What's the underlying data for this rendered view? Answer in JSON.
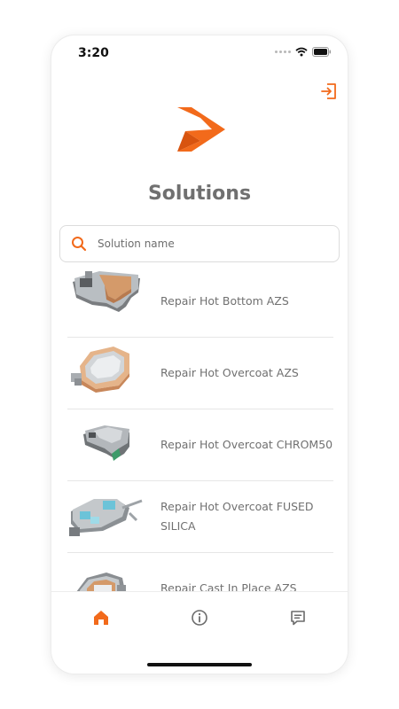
{
  "status_bar": {
    "time": "3:20"
  },
  "header": {
    "title": "Solutions"
  },
  "search": {
    "placeholder": "Solution name",
    "value": ""
  },
  "solutions": [
    {
      "label": "Repair Hot Bottom AZS"
    },
    {
      "label": "Repair Hot Overcoat AZS"
    },
    {
      "label": "Repair Hot Overcoat CHROM50"
    },
    {
      "label": "Repair Hot Overcoat FUSED SILICA"
    },
    {
      "label": "Repair Cast In Place AZS"
    }
  ],
  "bottom_nav": {
    "items": [
      "home-icon",
      "info-icon",
      "message-icon"
    ],
    "active": "home-icon"
  },
  "colors": {
    "accent": "#f26a1b",
    "title": "#707070",
    "text": "#707070",
    "inactive_icon": "#6b6b6b"
  }
}
